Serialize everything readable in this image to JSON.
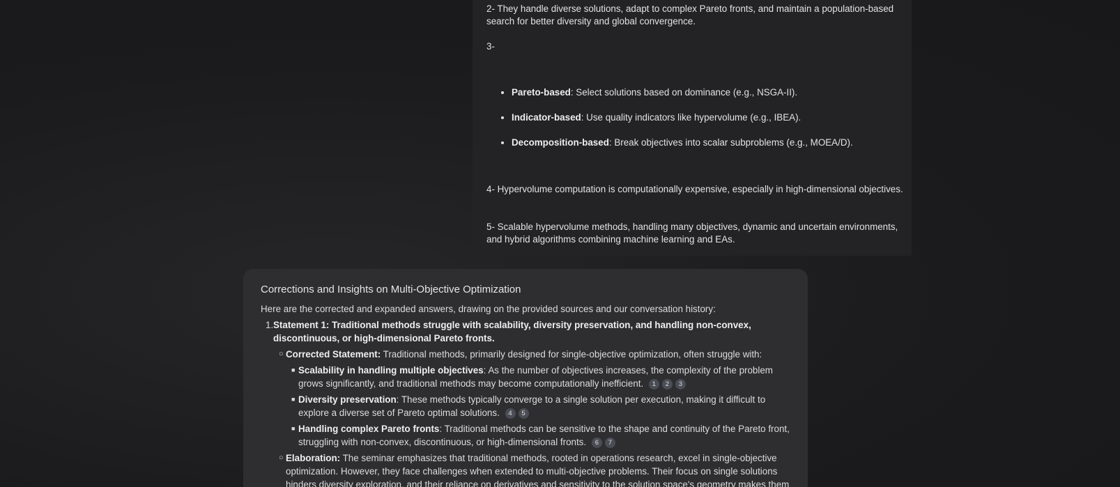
{
  "user_message": {
    "p2": "2- They handle diverse solutions, adapt to complex Pareto fronts, and maintain a population-based search for better diversity and global convergence.",
    "p3": "3-",
    "bullets": [
      {
        "bold": "Pareto-based",
        "text": ": Select solutions based on dominance (e.g., NSGA-II)."
      },
      {
        "bold": "Indicator-based",
        "text": ": Use quality indicators like hypervolume (e.g., IBEA)."
      },
      {
        "bold": "Decomposition-based",
        "text": ": Break objectives into scalar subproblems (e.g., MOEA/D)."
      }
    ],
    "p4": "4- Hypervolume computation is computationally expensive, especially in high-dimensional objectives.",
    "p5": "5- Scalable hypervolume methods, handling many objectives, dynamic and uncertain environments, and hybrid algorithms combining machine learning and EAs."
  },
  "response": {
    "title": "Corrections and Insights on Multi-Objective Optimization",
    "intro": "Here are the corrected and expanded answers, drawing on the provided sources and our conversation history:",
    "item1": {
      "num": "1.",
      "bold": "Statement 1: Traditional methods struggle with scalability, diversity preservation, and handling non-convex, discontinuous, or high-dimensional Pareto fronts.",
      "corrected_mark": "○",
      "corrected_bold": "Corrected Statement:",
      "corrected_text": " Traditional methods, primarily designed for single-objective optimization, often struggle with:",
      "subitems": [
        {
          "mark": "■",
          "bold": "Scalability in handling multiple objectives",
          "text": ": As the number of objectives increases, the complexity of the problem grows significantly, and traditional methods may become computationally inefficient.",
          "cites": [
            "1",
            "2",
            "3"
          ]
        },
        {
          "mark": "■",
          "bold": "Diversity preservation",
          "text": ": These methods typically converge to a single solution per execution, making it difficult to explore a diverse set of Pareto optimal solutions.",
          "cites": [
            "4",
            "5"
          ]
        },
        {
          "mark": "■",
          "bold": "Handling complex Pareto fronts",
          "text": ": Traditional methods can be sensitive to the shape and continuity of the Pareto front, struggling with non-convex, discontinuous, or high-dimensional fronts.",
          "cites": [
            "6",
            "7"
          ]
        }
      ],
      "elab_mark": "○",
      "elab_bold": "Elaboration:",
      "elab_text": " The seminar emphasizes that traditional methods, rooted in operations research, excel in single-objective optimization. However, they face challenges when extended to multi-objective problems. Their focus on single solutions hinders diversity exploration, and their reliance on derivatives and sensitivity to the solution space's geometry makes them"
    }
  }
}
